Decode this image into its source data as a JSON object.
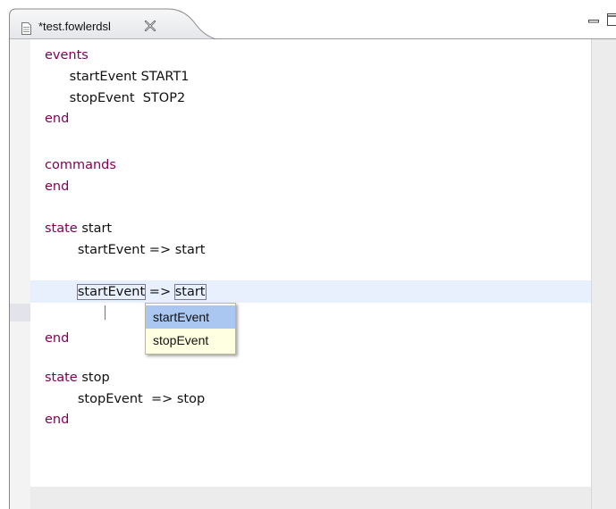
{
  "tab": {
    "title": "*test.fowlerdsl",
    "file_icon": "document-icon",
    "close_icon": "close-x-icon"
  },
  "window_controls": {
    "minimize_icon": "minimize-icon",
    "maximize_icon": "maximize-icon"
  },
  "code": {
    "lines": [
      {
        "kw": "events",
        "rest": ""
      },
      {
        "indent": "      ",
        "kw": "",
        "rest": "startEvent START1"
      },
      {
        "indent": "      ",
        "kw": "",
        "rest": "stopEvent  STOP2"
      },
      {
        "kw": "end",
        "rest": ""
      },
      {
        "kw": "commands",
        "rest": ""
      },
      {
        "kw": "end",
        "rest": ""
      },
      {
        "kw": "state",
        "rest": " start"
      },
      {
        "indent": "        ",
        "rest": "startEvent => start"
      },
      {
        "indent": "        ",
        "word1": "startEvent",
        "mid": " => ",
        "word2": "start"
      },
      {
        "kw": "end",
        "rest": ""
      },
      {
        "kw": "state",
        "rest": " stop"
      },
      {
        "indent": "        ",
        "rest": "stopEvent  => stop"
      },
      {
        "kw": "end",
        "rest": ""
      }
    ]
  },
  "autocomplete": {
    "items": [
      "startEvent",
      "stopEvent"
    ],
    "selected_index": 0
  },
  "colors": {
    "keyword": "#7f0055",
    "current_line": "#e8f0fe",
    "popup_bg": "#ffffe1",
    "popup_selected": "#a9c7f0"
  }
}
